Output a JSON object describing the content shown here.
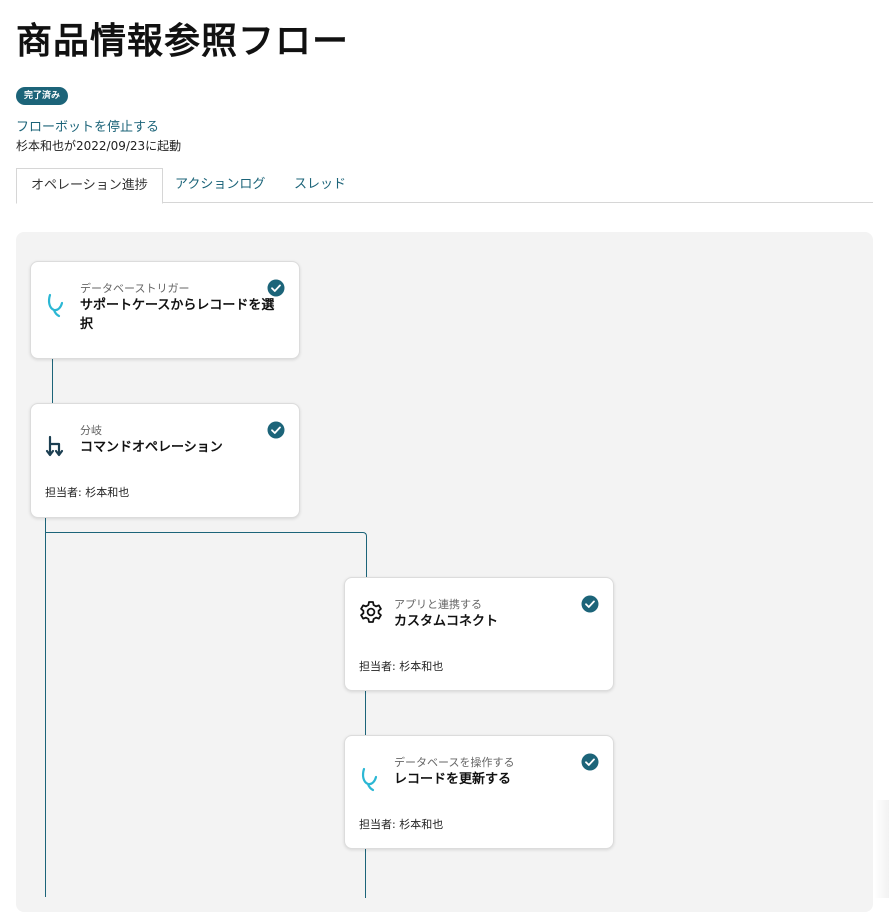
{
  "header": {
    "title": "商品情報参照フロー",
    "status_badge": "完了済み",
    "stop_link": "フローボットを停止する",
    "started_by": "杉本和也が2022/09/23に起動"
  },
  "tabs": [
    {
      "label": "オペレーション進捗",
      "active": true
    },
    {
      "label": "アクションログ",
      "active": false
    },
    {
      "label": "スレッド",
      "active": false
    }
  ],
  "flow": {
    "cards": [
      {
        "type": "データベーストリガー",
        "title": "サポートケースからレコードを選択",
        "icon": "database-icon",
        "status": "completed",
        "assignee": ""
      },
      {
        "type": "分岐",
        "title": "コマンドオペレーション",
        "icon": "branch-icon",
        "status": "completed",
        "assignee": "担当者: 杉本和也"
      },
      {
        "type": "アプリと連携する",
        "title": "カスタムコネクト",
        "icon": "gear-icon",
        "status": "completed",
        "assignee": "担当者: 杉本和也"
      },
      {
        "type": "データベースを操作する",
        "title": "レコードを更新する",
        "icon": "database-icon",
        "status": "completed",
        "assignee": "担当者: 杉本和也"
      }
    ]
  },
  "colors": {
    "accent": "#1c6479",
    "database_icon": "#2bb7d4",
    "canvas_bg": "#f3f3f3"
  }
}
